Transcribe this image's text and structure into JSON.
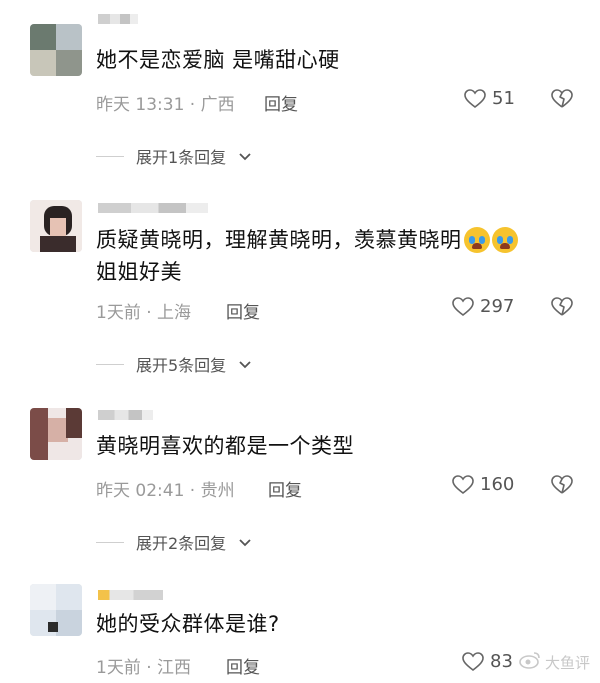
{
  "comments": [
    {
      "text": "她不是恋爱脑 是嘴甜心硬",
      "meta": "昨天 13:31 · 广西",
      "reply_label": "回复",
      "likes": "51",
      "expand_label": "展开1条回复",
      "has_emoji": false
    },
    {
      "text": "质疑黄晓明，理解黄晓明，羡慕黄晓明",
      "text_line2": "姐姐好美",
      "meta": "1天前 · 上海",
      "reply_label": "回复",
      "likes": "297",
      "expand_label": "展开5条回复",
      "emoji": [
        "crying-face",
        "crying-face"
      ]
    },
    {
      "text": "黄晓明喜欢的都是一个类型",
      "meta": "昨天 02:41 · 贵州",
      "reply_label": "回复",
      "likes": "160",
      "expand_label": "展开2条回复"
    },
    {
      "text": "她的受众群体是谁?",
      "meta": "1天前 · 江西",
      "reply_label": "回复",
      "likes": "83"
    }
  ],
  "watermark": "大鱼评"
}
